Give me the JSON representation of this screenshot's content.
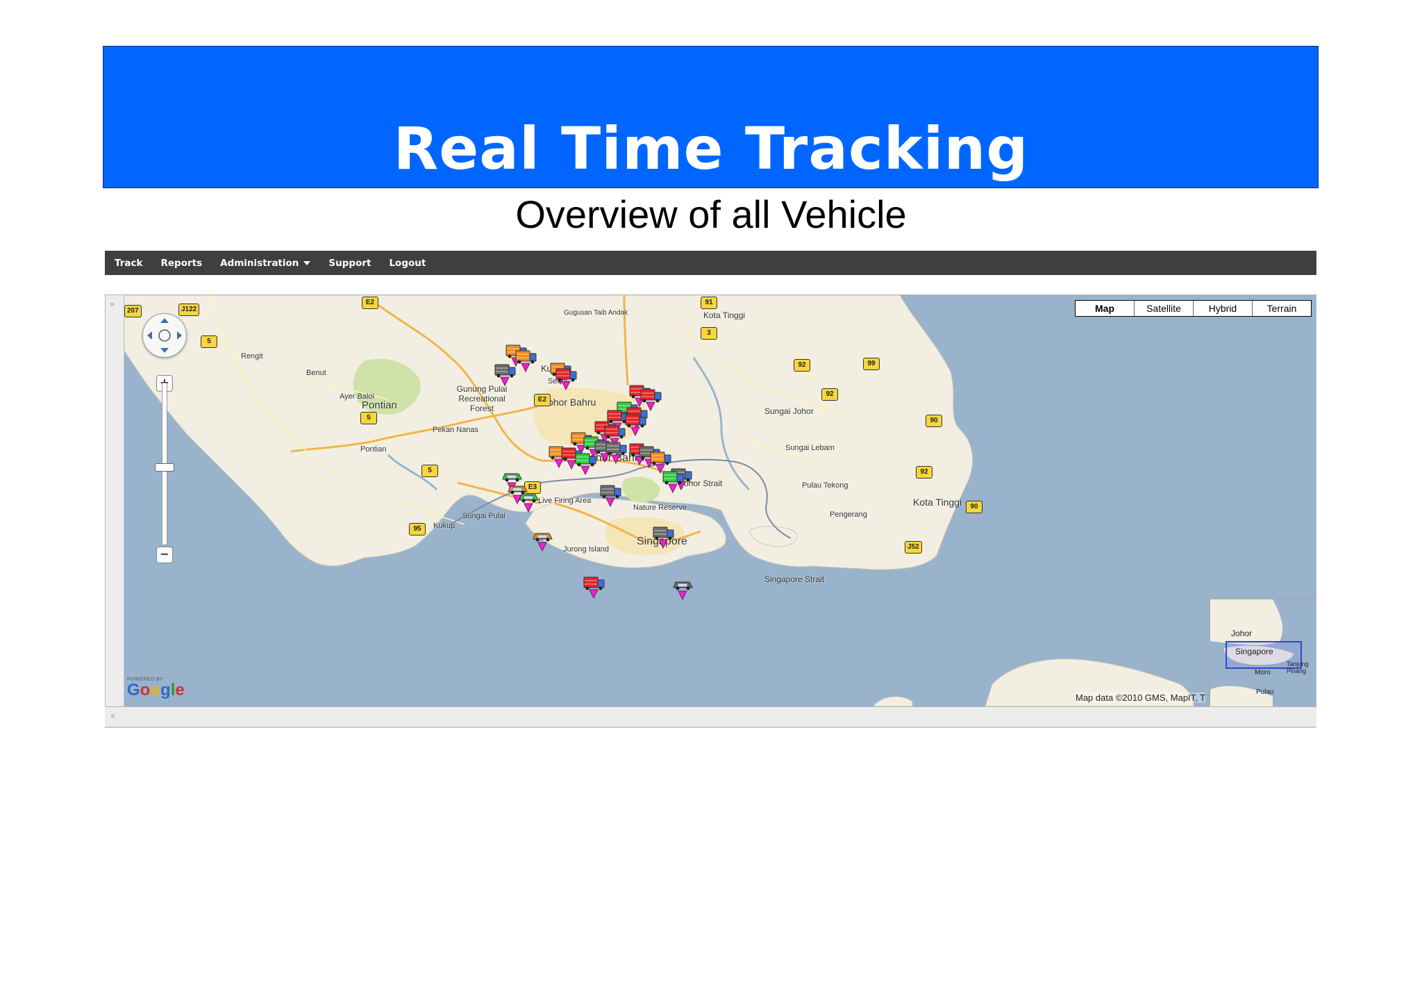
{
  "slide": {
    "title": "Real Time Tracking",
    "subtitle": "Overview of all Vehicle"
  },
  "nav": {
    "items": [
      "Track",
      "Reports",
      "Administration",
      "Support",
      "Logout"
    ]
  },
  "map": {
    "map_types": [
      "Map",
      "Satellite",
      "Hybrid",
      "Terrain"
    ],
    "selected_type": "Map",
    "attribution": "Map data ©2010 GMS, MapIT, T",
    "powered_by": "POWERED BY",
    "logo_text": "Google",
    "place_labels": [
      "Kota Tinggi",
      "Rengit",
      "Benut",
      "Ayer Baloi",
      "Pontian",
      "Pontian",
      "Gunung Pulai Recreational Forest",
      "Kulai",
      "Senai",
      "Johor Bahru",
      "Pekan Nanas",
      "Sungai Johor",
      "Sungai Lebam",
      "Johor Bahru",
      "Johor Strait",
      "Pulau Tekong",
      "Pengerang",
      "Kota Tinggi",
      "Live Firing Area",
      "Nature Reserve",
      "Sungai Pulai",
      "Kukup",
      "Singapore",
      "Jurong Island",
      "Singapore Strait",
      "Gugusan Taib Andak"
    ],
    "route_shields": [
      "207",
      "J122",
      "E2",
      "91",
      "5",
      "3",
      "92",
      "99",
      "92",
      "E2",
      "90",
      "5",
      "92",
      "5",
      "E3",
      "90",
      "95",
      "J52"
    ],
    "overview_labels": [
      "Johor",
      "Singapore",
      "Moro",
      "Pulau",
      "Tanjung Pinang"
    ],
    "vehicle_colors": {
      "orange": "#f28c1e",
      "red": "#e5242a",
      "green": "#2ecc40",
      "grey": "#6b6b6b",
      "marker": "#ee22cc"
    }
  }
}
